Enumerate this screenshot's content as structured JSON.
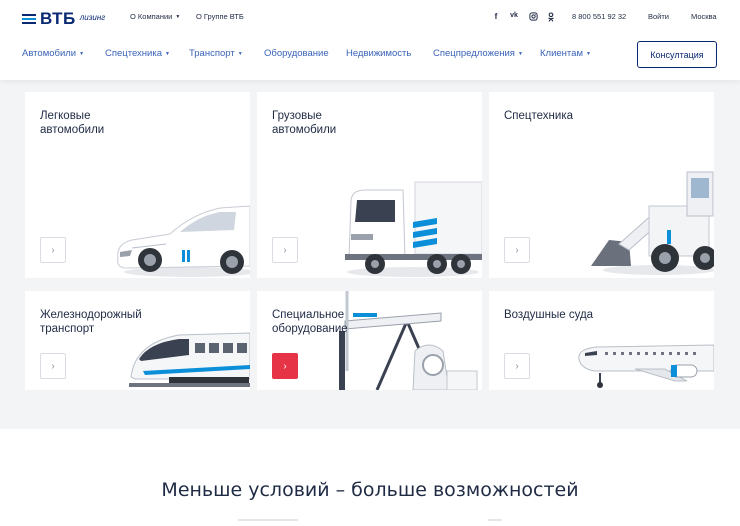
{
  "header": {
    "logo_brand": "ВТБ",
    "logo_sub": "лизинг",
    "top_links": [
      {
        "label": "О Компании",
        "has_caret": true
      },
      {
        "label": "О Группе ВТБ",
        "has_caret": false
      }
    ],
    "social": [
      "f",
      "vk",
      "ig",
      "ok"
    ],
    "phone": "8 800 551 92 32",
    "login": "Войти",
    "city": "Москва",
    "nav": [
      {
        "label": "Автомобили",
        "has_caret": true
      },
      {
        "label": "Спецтехника",
        "has_caret": true
      },
      {
        "label": "Транспорт",
        "has_caret": true
      },
      {
        "label": "Оборудование",
        "has_caret": false
      },
      {
        "label": "Недвижимость",
        "has_caret": false
      },
      {
        "label": "Спецпредложения",
        "has_caret": true
      },
      {
        "label": "Клиентам",
        "has_caret": true
      }
    ],
    "consult_label": "Консултация"
  },
  "cards": [
    {
      "title": "Легковые\nавтомобили",
      "icon": "car-image",
      "active": false
    },
    {
      "title": "Грузовые\nавтомобили",
      "icon": "truck-image",
      "active": false
    },
    {
      "title": "Спецтехника",
      "icon": "loader-image",
      "active": false
    },
    {
      "title": "Железнодорожный\nтранспорт",
      "icon": "train-image",
      "active": false
    },
    {
      "title": "Специальное\nоборудование",
      "icon": "pumpjack-image",
      "active": true
    },
    {
      "title": "Воздушные суда",
      "icon": "airplane-image",
      "active": false
    }
  ],
  "arrow_glyph": "›",
  "bottom": {
    "title": "Меньше условий – больше возможностей"
  },
  "colors": {
    "brand": "#0a2973",
    "accent_blue": "#0b8fd8",
    "nav": "#3a64b8",
    "active_red": "#e63346"
  }
}
